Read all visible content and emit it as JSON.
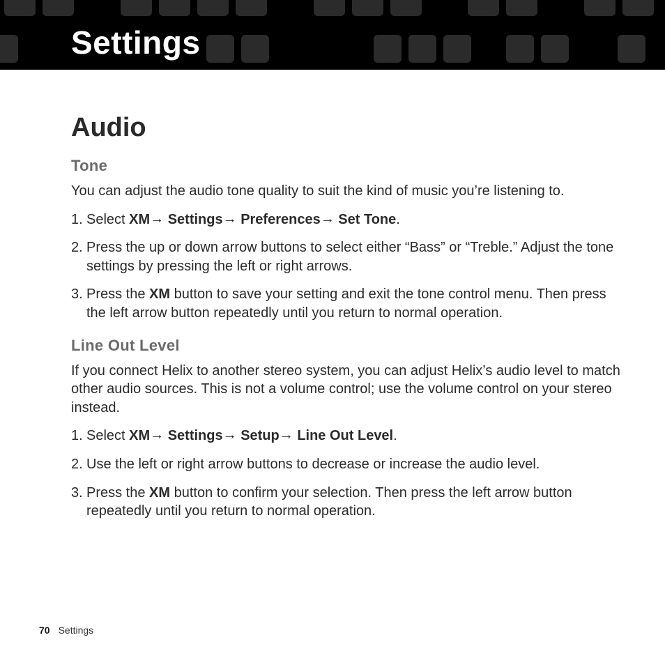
{
  "symbols": {
    "arrow": " → "
  },
  "header": {
    "title": "Settings"
  },
  "content": {
    "section_title": "Audio",
    "tone": {
      "heading": "Tone",
      "intro": "You can adjust the audio tone quality to suit the kind of music you’re listening to.",
      "steps": [
        {
          "num": "1. ",
          "pre": "Select ",
          "path": [
            "XM",
            "Settings",
            "Preferences",
            "Set Tone"
          ],
          "post": "."
        },
        {
          "num": "2. ",
          "text": "Press the up or down arrow buttons to select either “Bass” or “Treble.” Adjust the tone settings by pressing the left or right arrows."
        },
        {
          "num": "3. ",
          "pre": "Press the ",
          "bold": "XM",
          "post": " button to save your setting and exit the tone control menu. Then press the left arrow button repeatedly until you return to normal operation."
        }
      ]
    },
    "lineout": {
      "heading": "Line Out Level",
      "intro": "If you connect Helix to another stereo system, you can adjust Helix’s audio level to match other audio sources. This is not a volume control; use the volume control on your stereo instead.",
      "steps": [
        {
          "num": "1. ",
          "pre": "Select ",
          "path": [
            "XM",
            "Settings",
            "Setup",
            "Line Out Level"
          ],
          "post": "."
        },
        {
          "num": "2. ",
          "text": "Use the left or right arrow buttons to decrease or increase the audio level."
        },
        {
          "num": "3. ",
          "pre": "Press the ",
          "bold": "XM",
          "post": " button to confirm your selection. Then press the left arrow button repeatedly until you return to normal operation."
        }
      ]
    }
  },
  "footer": {
    "page": "70",
    "label": "Settings"
  }
}
